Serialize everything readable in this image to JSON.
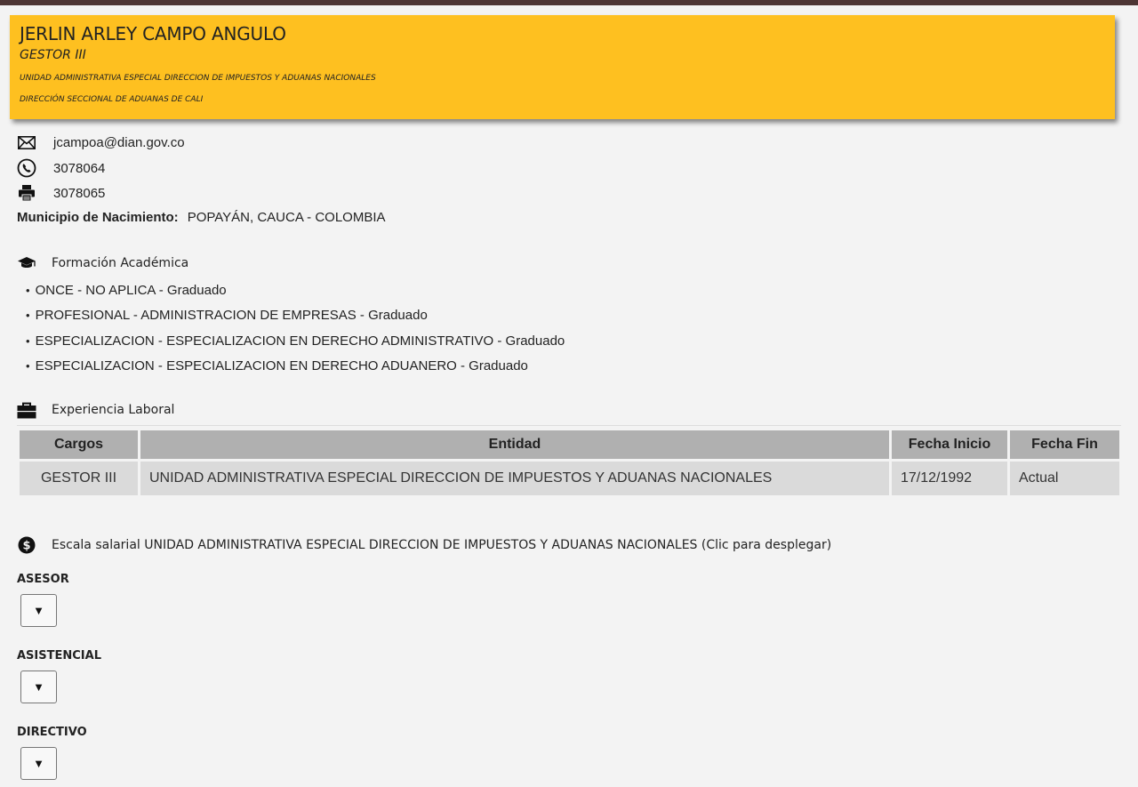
{
  "profile": {
    "name": "JERLIN ARLEY CAMPO ANGULO",
    "cargo": "GESTOR III",
    "entidad": "UNIDAD ADMINISTRATIVA ESPECIAL DIRECCION DE IMPUESTOS Y ADUANAS NACIONALES",
    "dependencia": "DIRECCIÓN SECCIONAL DE ADUANAS DE CALI"
  },
  "contact": {
    "email": "jcampoa@dian.gov.co",
    "phone": "3078064",
    "fax": "3078065",
    "municipio_label": "Municipio de Nacimiento:",
    "municipio_value": "POPAYÁN, CAUCA - COLOMBIA"
  },
  "education": {
    "title": "Formación Académica",
    "items": [
      "ONCE - NO APLICA - Graduado",
      "PROFESIONAL - ADMINISTRACION DE EMPRESAS - Graduado",
      "ESPECIALIZACION - ESPECIALIZACION EN DERECHO ADMINISTRATIVO - Graduado",
      "ESPECIALIZACION - ESPECIALIZACION EN DERECHO ADUANERO - Graduado"
    ]
  },
  "experience": {
    "title": "Experiencia Laboral",
    "headers": [
      "Cargos",
      "Entidad",
      "Fecha Inicio",
      "Fecha Fin"
    ],
    "rows": [
      [
        "GESTOR III",
        "UNIDAD ADMINISTRATIVA ESPECIAL DIRECCION DE IMPUESTOS Y ADUANAS NACIONALES",
        "17/12/1992",
        "Actual"
      ]
    ]
  },
  "salary": {
    "title": "Escala salarial UNIDAD ADMINISTRATIVA ESPECIAL DIRECCION DE IMPUESTOS Y ADUANAS NACIONALES (Clic para desplegar)",
    "toggle_glyph": "▼",
    "levels": [
      "ASESOR",
      "ASISTENCIAL",
      "DIRECTIVO"
    ]
  },
  "colors": {
    "card_bg": "#fec020",
    "top_bar": "#4d3534",
    "page_bg": "#f3f3f3"
  }
}
